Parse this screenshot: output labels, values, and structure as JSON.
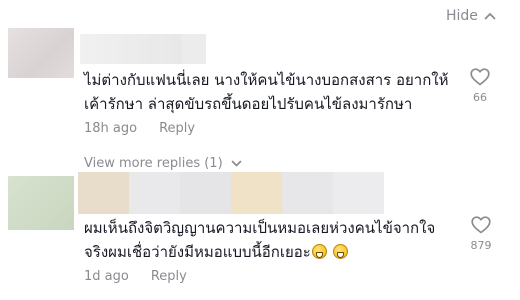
{
  "thread": {
    "hide_label": "Hide"
  },
  "comments": [
    {
      "text": "ไม่ต่างกับแฟนนี่เลย นางให้คนไข้นางบอกสงสาร อยากให้เค้ารักษา ล่าสุดขับรถขึ้นดอยไปรับคนไข้ลงมารักษา",
      "time": "18h ago",
      "reply_label": "Reply",
      "like_count": "66"
    },
    {
      "text": "ผมเห็นถึงจิตวิญญานความเป็นหมอเลยห่วงคนไข้จากใจ จริงผมเชื่อว่ายังมีหมอแบบนี้อีกเยอะ",
      "emojis": [
        "grinning-emoji",
        "grinning-emoji"
      ],
      "time": "1d ago",
      "reply_label": "Reply",
      "like_count": "879"
    }
  ],
  "view_more": {
    "label": "View more replies (1)"
  },
  "icons": {
    "hide": "chevron-up-icon",
    "like": "heart-outline-icon",
    "view_more": "chevron-down-icon"
  },
  "colors": {
    "text": "#161823",
    "muted": "#8a8b91",
    "background": "#ffffff"
  },
  "redacted": {
    "avatar_1_color": "#ddd7d8",
    "avatar_2_color": "#cfdbc6",
    "strip_colors": [
      "#e6d8c5",
      "#e9e9ea",
      "#e4e4e6",
      "#efe0c4",
      "#e6e6e8",
      "#ececec"
    ]
  }
}
